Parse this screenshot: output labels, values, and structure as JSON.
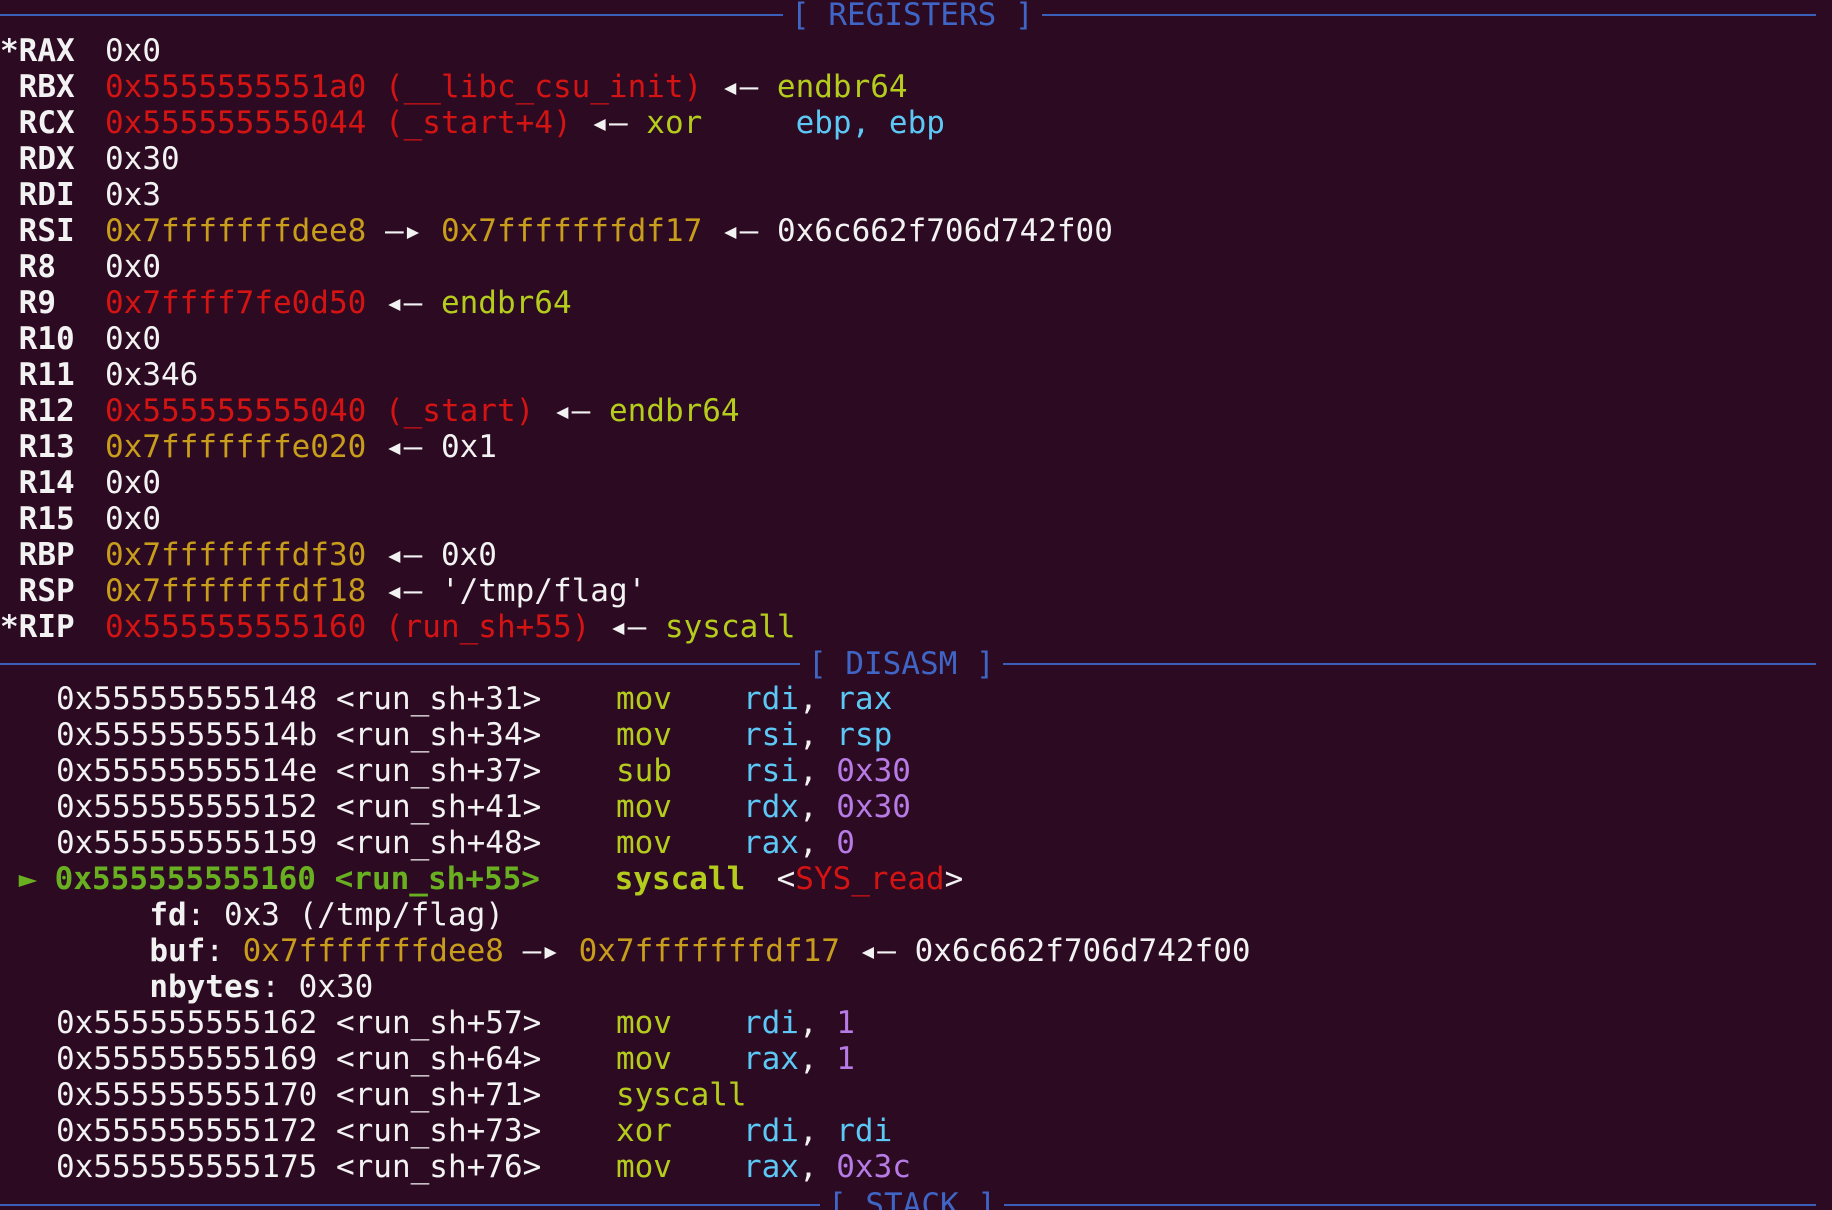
{
  "sections": {
    "registers": "[ REGISTERS ]",
    "disasm": "[ DISASM ]",
    "stack": "[ STACK ]"
  },
  "registers": [
    {
      "name": "*RAX",
      "value": "0x0"
    },
    {
      "name": " RBX",
      "value": "0x5555555551a0",
      "symbol": "(__libc_csu_init)",
      "arrow": "◂—",
      "target": "endbr64"
    },
    {
      "name": " RCX",
      "value": "0x555555555044",
      "symbol": "(_start+4)",
      "arrow": "◂—",
      "target": "xor",
      "operands": "ebp, ebp"
    },
    {
      "name": " RDX",
      "value": "0x30"
    },
    {
      "name": " RDI",
      "value": "0x3"
    },
    {
      "name": " RSI",
      "value": "0x7fffffffdee8",
      "arrow": "—▸",
      "value2": "0x7fffffffdf17",
      "arrow2": "◂—",
      "target": "0x6c662f706d742f00"
    },
    {
      "name": " R8",
      "value": "0x0"
    },
    {
      "name": " R9",
      "value": "0x7ffff7fe0d50",
      "arrow": "◂—",
      "target": "endbr64"
    },
    {
      "name": " R10",
      "value": "0x0"
    },
    {
      "name": " R11",
      "value": "0x346"
    },
    {
      "name": " R12",
      "value": "0x555555555040",
      "symbol": "(_start)",
      "arrow": "◂—",
      "target": "endbr64"
    },
    {
      "name": " R13",
      "value": "0x7fffffffe020",
      "arrow": "◂—",
      "target": "0x1"
    },
    {
      "name": " R14",
      "value": "0x0"
    },
    {
      "name": " R15",
      "value": "0x0"
    },
    {
      "name": " RBP",
      "value": "0x7fffffffdf30",
      "arrow": "◂—",
      "target": "0x0"
    },
    {
      "name": " RSP",
      "value": "0x7fffffffdf18",
      "arrow": "◂—",
      "target": "'/tmp/flag'"
    },
    {
      "name": "*RIP",
      "value": "0x555555555160",
      "symbol": "(run_sh+55)",
      "arrow": "◂—",
      "target": "syscall"
    }
  ],
  "disasm": {
    "before": [
      {
        "addr": "0x555555555148",
        "sym": "<run_sh+31>",
        "mnem": "mov",
        "op1": "rdi",
        "sep": ", ",
        "op2": "rax"
      },
      {
        "addr": "0x55555555514b",
        "sym": "<run_sh+34>",
        "mnem": "mov",
        "op1": "rsi",
        "sep": ", ",
        "op2": "rsp"
      },
      {
        "addr": "0x55555555514e",
        "sym": "<run_sh+37>",
        "mnem": "sub",
        "op1": "rsi",
        "sep": ", ",
        "op2": "0x30"
      },
      {
        "addr": "0x555555555152",
        "sym": "<run_sh+41>",
        "mnem": "mov",
        "op1": "rdx",
        "sep": ", ",
        "op2": "0x30"
      },
      {
        "addr": "0x555555555159",
        "sym": "<run_sh+48>",
        "mnem": "mov",
        "op1": "rax",
        "sep": ", ",
        "op2": "0"
      }
    ],
    "current": {
      "marker": "►",
      "addr": "0x555555555160",
      "sym": "<run_sh+55>",
      "mnem": "syscall",
      "lt": "<",
      "call": "SYS_read",
      "gt": ">"
    },
    "args": {
      "fd": {
        "label": "fd",
        "colon": ": ",
        "value": "0x3 (/tmp/flag)"
      },
      "buf": {
        "label": "buf",
        "colon": ": ",
        "value": "0x7fffffffdee8",
        "arrow": "—▸",
        "value2": "0x7fffffffdf17",
        "arrow2": "◂—",
        "target": "0x6c662f706d742f00"
      },
      "nbytes": {
        "label": "nbytes",
        "colon": ": ",
        "value": "0x30"
      }
    },
    "after": [
      {
        "addr": "0x555555555162",
        "sym": "<run_sh+57>",
        "mnem": "mov",
        "op1": "rdi",
        "sep": ", ",
        "op2": "1"
      },
      {
        "addr": "0x555555555169",
        "sym": "<run_sh+64>",
        "mnem": "mov",
        "op1": "rax",
        "sep": ", ",
        "op2": "1"
      },
      {
        "addr": "0x555555555170",
        "sym": "<run_sh+71>",
        "mnem": "syscall",
        "op1": "",
        "sep": "",
        "op2": ""
      },
      {
        "addr": "0x555555555172",
        "sym": "<run_sh+73>",
        "mnem": "xor",
        "op1": "rdi",
        "sep": ", ",
        "op2": "rdi"
      },
      {
        "addr": "0x555555555175",
        "sym": "<run_sh+76>",
        "mnem": "mov",
        "op1": "rax",
        "sep": ", ",
        "op2": "0x3c"
      }
    ]
  },
  "colors": {
    "background": "#2c0a22",
    "separator": "#3a5fb8",
    "red_pointer": "#d41313",
    "stack_pointer": "#c79d1b",
    "instruction": "#b4cc1c",
    "register_operand": "#5cc8f5",
    "immediate": "#b77be6",
    "current_line": "#69b021"
  }
}
